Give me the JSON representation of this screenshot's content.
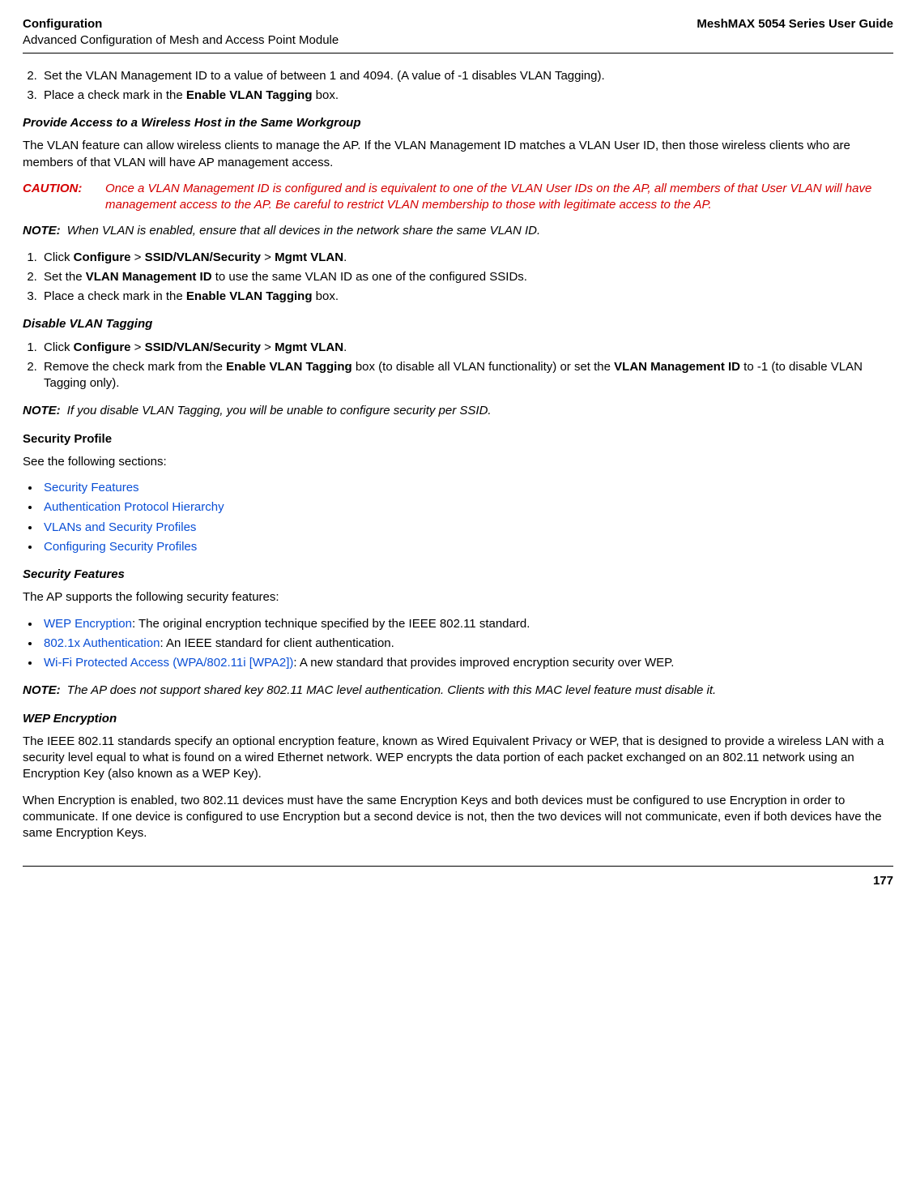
{
  "header": {
    "left_line1": "Configuration",
    "left_line2": "Advanced Configuration of Mesh and Access Point Module",
    "right": "MeshMAX 5054 Series User Guide"
  },
  "list1": {
    "item2_pre": "Set the VLAN Management ID to a value of between 1 and 4094. (A value of -1 disables VLAN Tagging).",
    "item3_pre": "Place a check mark in the ",
    "item3_b": "Enable VLAN Tagging",
    "item3_post": " box."
  },
  "sec_provide": {
    "heading": "Provide Access to a Wireless Host in the Same Workgroup",
    "para": "The VLAN feature can allow wireless clients to manage the AP. If the VLAN Management ID matches a VLAN User ID, then those wireless clients who are members of that VLAN will have AP management access."
  },
  "caution": {
    "label": "CAUTION:",
    "body": "Once a VLAN Management ID is configured and is equivalent to one of the VLAN User IDs on the AP, all members of that User VLAN will have management access to the AP. Be careful to restrict VLAN membership to those with legitimate access to the AP."
  },
  "note1": {
    "label": "NOTE:",
    "body": "When VLAN is enabled, ensure that all devices in the network share the same VLAN ID."
  },
  "list2": {
    "item1_pre": "Click ",
    "item1_b1": "Configure",
    "item1_sep1": " > ",
    "item1_b2": "SSID/VLAN/Security",
    "item1_sep2": " > ",
    "item1_b3": "Mgmt VLAN",
    "item1_post": ".",
    "item2_pre": "Set the ",
    "item2_b": "VLAN Management ID",
    "item2_post": " to use the same VLAN ID as one of the configured SSIDs.",
    "item3_pre": "Place a check mark in the ",
    "item3_b": "Enable VLAN Tagging",
    "item3_post": " box."
  },
  "sec_disable": {
    "heading": "Disable VLAN Tagging"
  },
  "list3": {
    "item1_pre": "Click ",
    "item1_b1": "Configure",
    "item1_sep1": " > ",
    "item1_b2": "SSID/VLAN/Security",
    "item1_sep2": " > ",
    "item1_b3": "Mgmt VLAN",
    "item1_post": ".",
    "item2_pre": "Remove the check mark from the ",
    "item2_b1": "Enable VLAN Tagging",
    "item2_mid": " box (to disable all VLAN functionality) or set the ",
    "item2_b2": "VLAN Management ID",
    "item2_post": " to -1 (to disable VLAN Tagging only)."
  },
  "note2": {
    "label": "NOTE:",
    "body": "If you disable VLAN Tagging, you will be unable to configure security per SSID."
  },
  "sec_profile": {
    "heading": "Security Profile",
    "intro": "See the following sections:"
  },
  "links": {
    "l1": "Security Features",
    "l2": "Authentication Protocol Hierarchy",
    "l3": "VLANs and Security Profiles",
    "l4": "Configuring Security Profiles"
  },
  "sec_features": {
    "heading": "Security Features",
    "intro": "The AP supports the following security features:"
  },
  "bullets": {
    "b1_link": "WEP Encryption",
    "b1_rest": ": The original encryption technique specified by the IEEE 802.11 standard.",
    "b2_link": "802.1x Authentication",
    "b2_rest": ": An IEEE standard for client authentication.",
    "b3_link": "Wi-Fi Protected Access (WPA/802.11i [WPA2])",
    "b3_rest": ": A new standard that provides improved encryption security over WEP."
  },
  "note3": {
    "label": "NOTE:",
    "body": "The AP does not support shared key 802.11 MAC level authentication. Clients with this MAC level feature must disable it."
  },
  "sec_wep": {
    "heading": "WEP Encryption",
    "para1": "The IEEE 802.11 standards specify an optional encryption feature, known as Wired Equivalent Privacy or WEP, that is designed to provide a wireless LAN with a security level equal to what is found on a wired Ethernet network. WEP encrypts the data portion of each packet exchanged on an 802.11 network using an Encryption Key (also known as a WEP Key).",
    "para2": "When Encryption is enabled, two 802.11 devices must have the same Encryption Keys and both devices must be configured to use Encryption in order to communicate. If one device is configured to use Encryption but a second device is not, then the two devices will not communicate, even if both devices have the same Encryption Keys."
  },
  "footer": {
    "page": "177"
  }
}
